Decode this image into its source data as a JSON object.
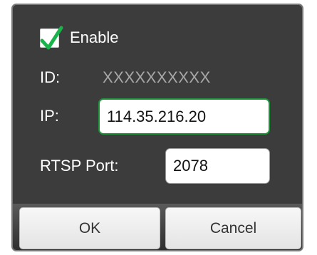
{
  "dialog": {
    "enable": {
      "label": "Enable",
      "checked": true,
      "check_color": "#18b34a"
    },
    "id": {
      "label": "ID:",
      "value": "XXXXXXXXXX"
    },
    "ip": {
      "label": "IP:",
      "value": "114.35.216.20",
      "focus_color": "#1f8f3a"
    },
    "rtsp_port": {
      "label": "RTSP Port:",
      "value": "2078"
    },
    "buttons": {
      "ok_label": "OK",
      "cancel_label": "Cancel"
    }
  }
}
